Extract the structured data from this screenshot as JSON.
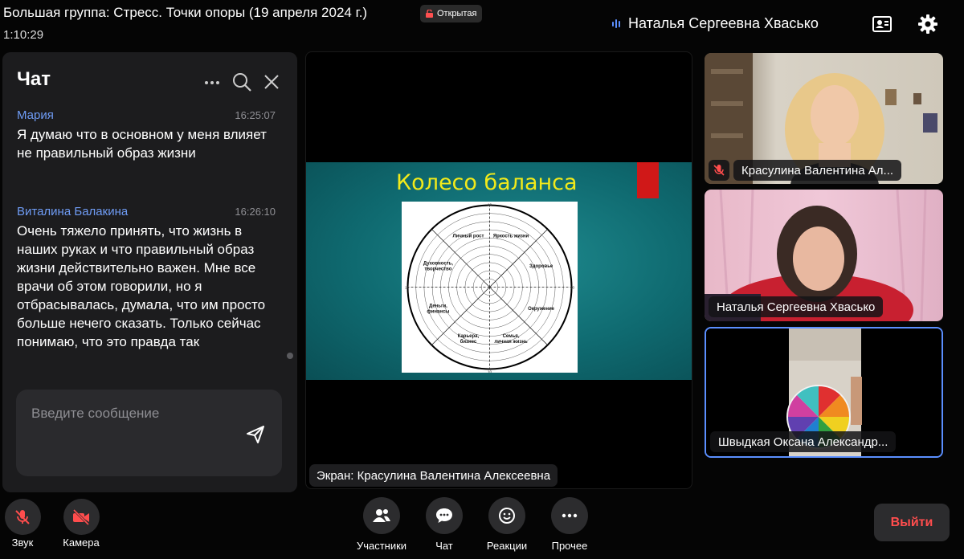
{
  "header": {
    "title": "Большая группа: Стресс. Точки опоры (19 апреля 2024 г.)",
    "badge": "Открытая",
    "timer": "1:10:29",
    "active_speaker": "Наталья Сергеевна Хвасько",
    "icons": [
      "lock-icon",
      "audio-level-icon",
      "contact-card-icon",
      "gear-icon"
    ]
  },
  "chat": {
    "title": "Чат",
    "messages": [
      {
        "author": "Мария",
        "time": "16:25:07",
        "text": "Я думаю что в основном у меня влияет не правильный образ жизни"
      },
      {
        "author": "Виталина Балакина",
        "time": "16:26:10",
        "text": "Очень тяжело принять, что жизнь в наших руках и что правильный образ жизни действительно важен. Мне все врачи об этом говорили, но я отбрасывалась, думала, что им просто больше нечего сказать. Только сейчас понимаю, что это правда так"
      }
    ],
    "input_placeholder": "Введите сообщение"
  },
  "screen_share": {
    "slide_title": "Колесо баланса",
    "wheel_labels": [
      "Яркость жизни",
      "Здоровье",
      "Окружение",
      "Семья, личная жизнь",
      "Карьера, бизнес",
      "Деньги, финансы",
      "Духовность, творчество",
      "Личный рост"
    ],
    "scale_label": "10",
    "label": "Экран: Красулина Валентина Алексеевна"
  },
  "participants": [
    {
      "name": "Красулина Валентина Ал...",
      "muted": true
    },
    {
      "name": "Наталья Сергеевна Хвасько",
      "muted": false
    },
    {
      "name": "Швыдкая Оксана Александр...",
      "muted": false,
      "active": true
    }
  ],
  "controls": {
    "sound": "Звук",
    "camera": "Камера",
    "participants": "Участники",
    "chat": "Чат",
    "reactions": "Реакции",
    "more": "Прочее",
    "exit": "Выйти"
  },
  "colors": {
    "accent": "#5b8fff",
    "danger": "#ff4d4d",
    "slide_title": "#f2ea1a"
  }
}
